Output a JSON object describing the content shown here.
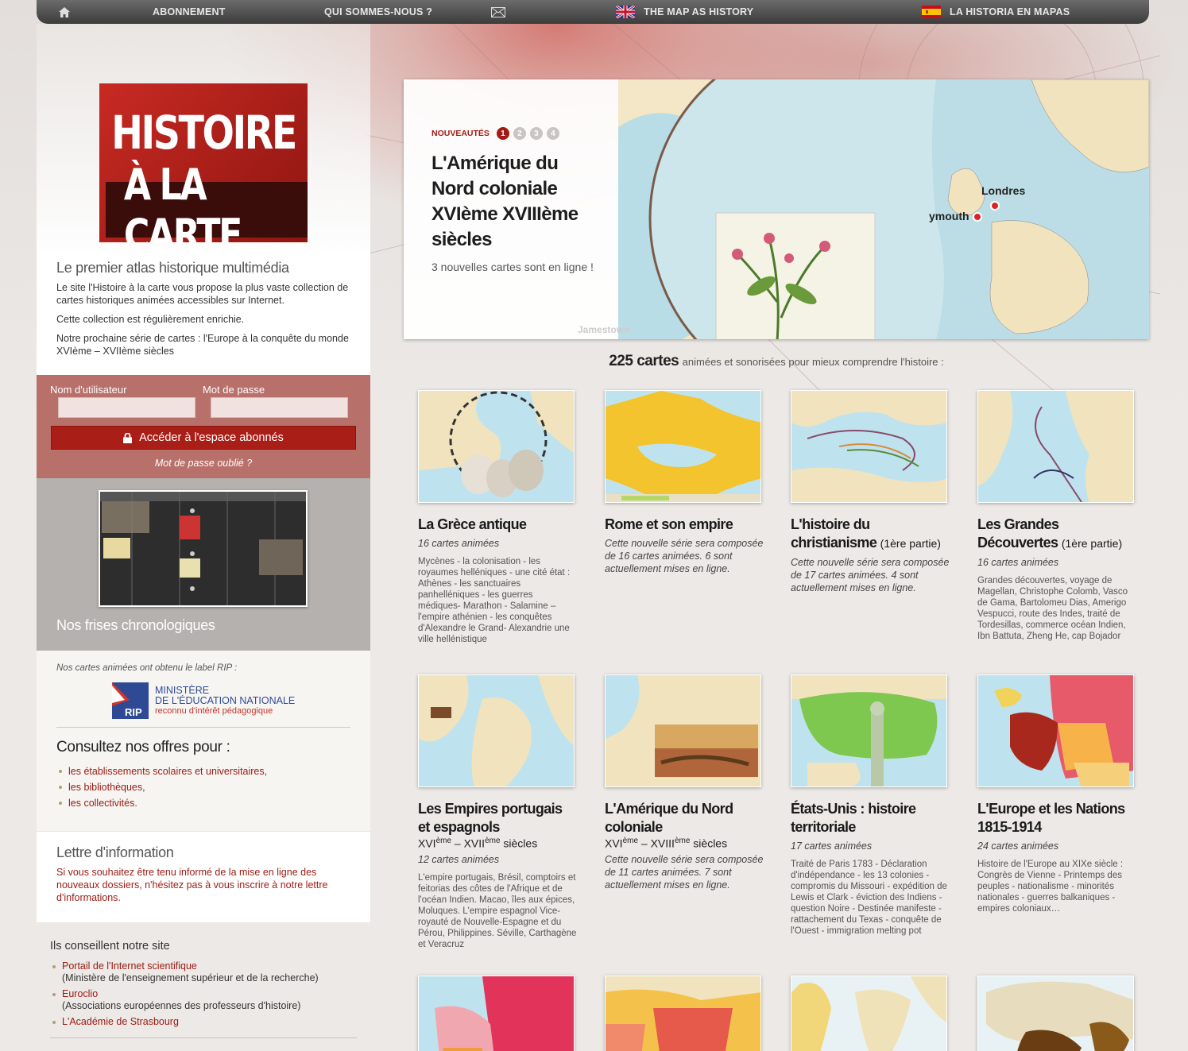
{
  "nav": {
    "subscribe": "ABONNEMENT",
    "about": "QUI SOMMES-NOUS ?",
    "english": "THE MAP AS HISTORY",
    "spanish": "LA HISTORIA EN MAPAS"
  },
  "logo": {
    "line1": "HISTOIRE",
    "line2": "À LA CARTE"
  },
  "intro": {
    "title": "Le premier atlas historique multimédia",
    "p1": "Le site l'Histoire à la carte vous propose la plus vaste collection de cartes historiques animées accessibles sur Internet.",
    "p2": "Cette collection est régulièrement enrichie.",
    "p3": "Notre prochaine série de cartes : l'Europe à la conquête du monde XVIème – XVIIème siècles"
  },
  "login": {
    "user_label": "Nom d'utilisateur",
    "pass_label": "Mot de passe",
    "button": "Accéder à l'espace abonnés",
    "forgot": "Mot de passe oublié ?"
  },
  "frises": {
    "title": "Nos frises chronologiques"
  },
  "offres": {
    "rip_label": "Nos cartes animées ont obtenu le label RIP :",
    "rip_line1": "MINISTÈRE",
    "rip_line2": "DE L'ÉDUCATION NATIONALE",
    "rip_line3": "reconnu d'intérêt pédagogique",
    "rip_badge": "RIP",
    "title": "Consultez nos offres pour :",
    "items": [
      "les établissements scolaires et universitaires,",
      "les bibliothèques,",
      "les collectivités."
    ]
  },
  "lettre": {
    "title": "Lettre d'information",
    "text": "Si vous souhaitez être tenu informé de la mise en ligne des nouveaux dossiers, n'hésitez pas à vous inscrire à notre lettre d'informations."
  },
  "conseil": {
    "title": "Ils conseillent notre site",
    "items": [
      {
        "link": "Portail de l'Internet scientifique",
        "sub": "(Ministère de l'enseignement supérieur et de la recherche)"
      },
      {
        "link": "Euroclio",
        "sub": "(Associations européennes des professeurs d'histoire)"
      },
      {
        "link": "L'Académie de Strasbourg",
        "sub": ""
      }
    ]
  },
  "hero": {
    "label": "NOUVEAUTÉS",
    "dots": [
      "1",
      "2",
      "3",
      "4"
    ],
    "title": "L'Amérique du Nord coloniale XVIème XVIIIème siècles",
    "subtitle": "3 nouvelles cartes sont en ligne !",
    "map_labels": {
      "london": "Londres",
      "plymouth": "ymouth",
      "jamestown": "Jamestown"
    }
  },
  "count": {
    "num": "225 cartes",
    "rest": "animées et sonorisées pour mieux comprendre l'histoire :"
  },
  "cards": [
    {
      "title": "La Grèce antique",
      "title_extra": "",
      "centuries": "",
      "count": "16 cartes animées",
      "desc": "Mycènes - la colonisation - les royaumes helléniques - une cité état : Athènes - les sanctuaires panhelléniques - les guerres médiques- Marathon - Salamine – l'empire athénien - les conquêtes d'Alexandre le Grand- Alexandrie une ville hellénistique"
    },
    {
      "title": "Rome et son empire",
      "title_extra": "",
      "centuries": "",
      "count": "Cette nouvelle série sera composée de 16 cartes animées. 6 sont actuellement mises en ligne.",
      "desc": ""
    },
    {
      "title": "L'histoire du christianisme",
      "title_extra": "(1ère partie)",
      "centuries": "",
      "count": "Cette nouvelle série sera composée de 17 cartes animées. 4 sont actuellement mises en ligne.",
      "desc": ""
    },
    {
      "title": "Les Grandes Découvertes",
      "title_extra": "(1ère partie)",
      "centuries": "",
      "count": "16 cartes animées",
      "desc": "Grandes découvertes, voyage de Magellan, Christophe Colomb, Vasco de Gama, Bartolomeu Dias, Amerigo Vespucci, route des Indes, traité de Tordesillas, commerce océan Indien, Ibn Battuta, Zheng He, cap Bojador"
    },
    {
      "title": "Les Empires portugais et espagnols",
      "title_extra": "",
      "centuries": "XVIème – XVIIème siècles",
      "count": "12 cartes animées",
      "desc": "L'empire portugais, Brésil, comptoirs et feitorias des côtes de l'Afrique et de l'océan Indien. Macao, îles aux épices, Moluques. L'empire espagnol Vice-royauté de Nouvelle-Espagne et du Pérou, Philippines. Séville, Carthagène et Veracruz"
    },
    {
      "title": "L'Amérique du Nord coloniale",
      "title_extra": "",
      "centuries": "XVIème – XVIIIème siècles",
      "count": "Cette nouvelle série sera composée de 11 cartes animées. 7 sont actuellement mises en ligne.",
      "desc": ""
    },
    {
      "title": "États-Unis : histoire territoriale",
      "title_extra": "",
      "centuries": "",
      "count": "17 cartes animées",
      "desc": "Traité de Paris 1783 - Déclaration d'indépendance - les 13 colonies - compromis du Missouri - expédition de Lewis et Clark - éviction des Indiens - question Noire - Destinée manifeste - rattachement du Texas - conquête de l'Ouest - immigration melting pot"
    },
    {
      "title": "L'Europe et les Nations 1815-1914",
      "title_extra": "",
      "centuries": "",
      "count": "24 cartes animées",
      "desc": "Histoire de l'Europe au XIXe siècle : Congrès de Vienne - Printemps des peuples - nationalisme - minorités nationales - guerres balkaniques - empires coloniaux…"
    }
  ],
  "colors": {
    "accent": "#a91e17",
    "link": "#9a1a12",
    "login_bg": "#b8706b"
  }
}
